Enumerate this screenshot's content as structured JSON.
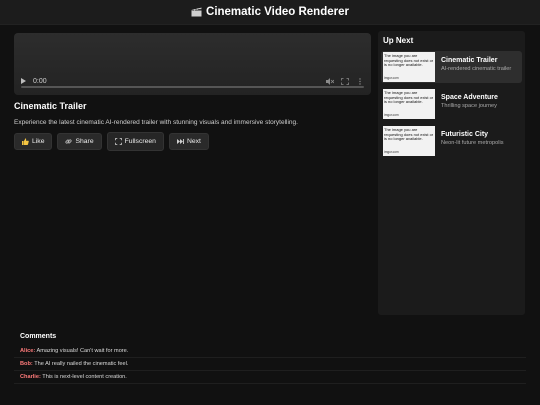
{
  "header": {
    "title": "Cinematic Video Renderer",
    "icon": "clapperboard-icon"
  },
  "player": {
    "time": "0:00",
    "progress": 0
  },
  "video": {
    "title": "Cinematic Trailer",
    "description": "Experience the latest cinematic AI-rendered trailer with stunning visuals and immersive storytelling."
  },
  "actions": {
    "like": "Like",
    "share": "Share",
    "fullscreen": "Fullscreen",
    "next": "Next"
  },
  "sidebar": {
    "heading": "Up Next",
    "items": [
      {
        "name": "Cinematic Trailer",
        "sub": "AI-rendered cinematic trailer",
        "active": true
      },
      {
        "name": "Space Adventure",
        "sub": "Thrilling space journey",
        "active": false
      },
      {
        "name": "Futuristic City",
        "sub": "Neon-lit future metropolis",
        "active": false
      }
    ],
    "thumb_notice": "The image you are requesting does not exist or is no longer available.",
    "thumb_brand": "imgur.com"
  },
  "comments": {
    "heading": "Comments",
    "items": [
      {
        "author": "Alice:",
        "text": "Amazing visuals! Can't wait for more."
      },
      {
        "author": "Bob:",
        "text": "The AI really nailed the cinematic feel."
      },
      {
        "author": "Charlie:",
        "text": "This is next-level content creation."
      }
    ]
  },
  "colors": {
    "background": "#111111",
    "panel": "#1b1b1b",
    "comment_author": "#ff7b7b"
  }
}
